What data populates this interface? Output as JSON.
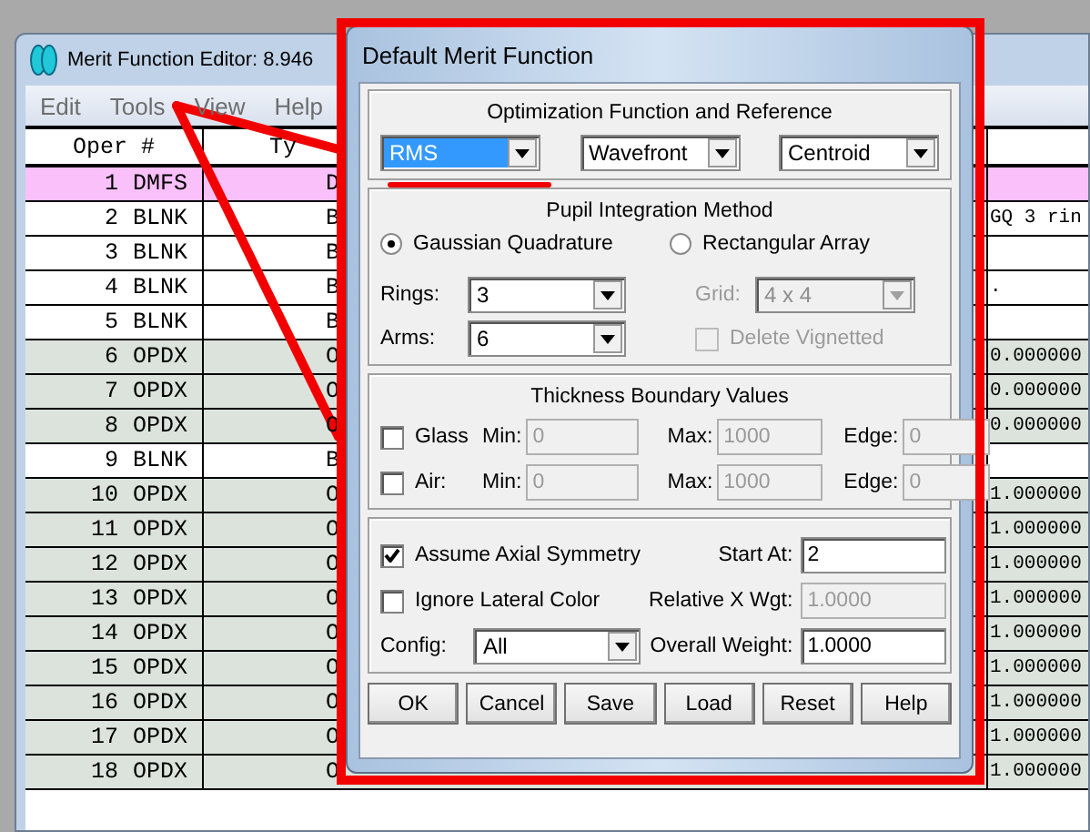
{
  "editor": {
    "title": "Merit Function Editor: 8.946",
    "menu": [
      "Edit",
      "Tools",
      "View",
      "Help"
    ],
    "columns": [
      "Oper #",
      "Ty"
    ],
    "rows": [
      {
        "number": "1",
        "operand": "DMFS",
        "type": "D",
        "column_3": "",
        "kind": "dmfs"
      },
      {
        "number": "2",
        "operand": "BLNK",
        "type": "B",
        "column_3": "GQ 3 rin",
        "kind": "blnk"
      },
      {
        "number": "3",
        "operand": "BLNK",
        "type": "B",
        "column_3": "",
        "kind": "blnk"
      },
      {
        "number": "4",
        "operand": "BLNK",
        "type": "B",
        "column_3": ".",
        "kind": "blnk"
      },
      {
        "number": "5",
        "operand": "BLNK",
        "type": "B",
        "column_3": "",
        "kind": "blnk"
      },
      {
        "number": "6",
        "operand": "OPDX",
        "type": "O",
        "column_3": "0.000000",
        "kind": "opdx"
      },
      {
        "number": "7",
        "operand": "OPDX",
        "type": "O",
        "column_3": "0.000000",
        "kind": "opdx"
      },
      {
        "number": "8",
        "operand": "OPDX",
        "type": "O",
        "column_3": "0.000000",
        "kind": "opdx"
      },
      {
        "number": "9",
        "operand": "BLNK",
        "type": "B",
        "column_3": "",
        "kind": "blnk"
      },
      {
        "number": "10",
        "operand": "OPDX",
        "type": "O",
        "column_3": "1.000000",
        "kind": "opdx"
      },
      {
        "number": "11",
        "operand": "OPDX",
        "type": "O",
        "column_3": "1.000000",
        "kind": "opdx"
      },
      {
        "number": "12",
        "operand": "OPDX",
        "type": "O",
        "column_3": "1.000000",
        "kind": "opdx"
      },
      {
        "number": "13",
        "operand": "OPDX",
        "type": "O",
        "column_3": "1.000000",
        "kind": "opdx"
      },
      {
        "number": "14",
        "operand": "OPDX",
        "type": "O",
        "column_3": "1.000000",
        "kind": "opdx"
      },
      {
        "number": "15",
        "operand": "OPDX",
        "type": "O",
        "column_3": "1.000000",
        "kind": "opdx"
      },
      {
        "number": "16",
        "operand": "OPDX",
        "type": "O",
        "column_3": "1.000000",
        "kind": "opdx"
      },
      {
        "number": "17",
        "operand": "OPDX",
        "type": "O",
        "column_3": "1.000000",
        "kind": "opdx"
      },
      {
        "number": "18",
        "operand": "OPDX",
        "type": "O",
        "column_3": "1.000000",
        "kind": "opdx"
      }
    ]
  },
  "dialog": {
    "title": "Default Merit Function",
    "optimization": {
      "title": "Optimization Function and Reference",
      "dropdowns": [
        {
          "value": "RMS",
          "focused": true
        },
        {
          "value": "Wavefront",
          "focused": false
        },
        {
          "value": "Centroid",
          "focused": false
        }
      ]
    },
    "pupil": {
      "title": "Pupil Integration Method",
      "methods": [
        {
          "label": "Gaussian Quadrature",
          "selected": true
        },
        {
          "label": "Rectangular Array",
          "selected": false
        }
      ],
      "rings": {
        "label": "Rings:",
        "value": "3"
      },
      "arms": {
        "label": "Arms:",
        "value": "6"
      },
      "grid": {
        "label": "Grid:",
        "value": "4 x 4",
        "disabled": true
      },
      "delete_vignetted": {
        "label": "Delete Vignetted",
        "checked": false,
        "disabled": true
      }
    },
    "thickness": {
      "title": "Thickness Boundary Values",
      "rows": [
        {
          "label": "Glass",
          "checked": false,
          "min_label": "Min:",
          "min": "0",
          "max_label": "Max:",
          "max": "1000",
          "edge_label": "Edge:",
          "edge": "0",
          "disabled": true
        },
        {
          "label": "Air:",
          "checked": false,
          "min_label": "Min:",
          "min": "0",
          "max_label": "Max:",
          "max": "1000",
          "edge_label": "Edge:",
          "edge": "0",
          "disabled": true
        }
      ]
    },
    "options": {
      "checks": [
        {
          "label": "Assume Axial Symmetry",
          "checked": true
        },
        {
          "label": "Ignore Lateral Color",
          "checked": false
        }
      ],
      "config": {
        "label": "Config:",
        "value": "All"
      },
      "fields": [
        {
          "label": "Start At:",
          "value": "2",
          "disabled": false
        },
        {
          "label": "Relative X Wgt:",
          "value": "1.0000",
          "disabled": true
        },
        {
          "label": "Overall Weight:",
          "value": "1.0000",
          "disabled": false
        }
      ]
    },
    "buttons": [
      "OK",
      "Cancel",
      "Save",
      "Load",
      "Reset",
      "Help"
    ]
  }
}
